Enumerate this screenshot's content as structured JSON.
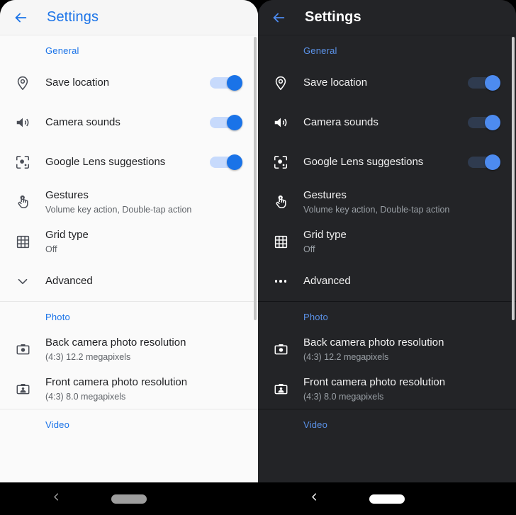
{
  "colors": {
    "light_bg": "#fafafa",
    "dark_bg": "#232427",
    "accent_light": "#1a73e8",
    "accent_dark": "#5b92e8",
    "toggle_track_light": "#c7dafc",
    "toggle_track_dark": "#2f3b4f",
    "toggle_knob_light": "#1a73e8",
    "toggle_knob_dark": "#4d8bf0",
    "navbar_bg": "#000000"
  },
  "panels": [
    {
      "theme": "light",
      "header": {
        "title": "Settings",
        "back_icon": "arrow-left-icon"
      },
      "advanced_icon": "chevron-down-icon",
      "navbar": {
        "back_icon": "chevron-left-icon",
        "home_indicator": "pill-home-indicator"
      }
    },
    {
      "theme": "dark",
      "header": {
        "title": "Settings",
        "back_icon": "arrow-left-icon"
      },
      "advanced_icon": "overflow-dots-icon",
      "navbar": {
        "back_icon": "chevron-left-icon",
        "home_indicator": "pill-home-indicator"
      }
    }
  ],
  "sections": [
    {
      "label": "General",
      "rows": [
        {
          "icon": "location-pin-icon",
          "title": "Save location",
          "subtitle": "",
          "control": "toggle",
          "toggle_on": true
        },
        {
          "icon": "volume-up-icon",
          "title": "Camera sounds",
          "subtitle": "",
          "control": "toggle",
          "toggle_on": true
        },
        {
          "icon": "google-lens-icon",
          "title": "Google Lens suggestions",
          "subtitle": "",
          "control": "toggle",
          "toggle_on": true
        },
        {
          "icon": "touch-gesture-icon",
          "title": "Gestures",
          "subtitle": "Volume key action, Double-tap action",
          "control": "none"
        },
        {
          "icon": "grid-icon",
          "title": "Grid type",
          "subtitle": "Off",
          "control": "none"
        },
        {
          "icon": "advanced-expand-icon",
          "title": "Advanced",
          "subtitle": "",
          "control": "none"
        }
      ]
    },
    {
      "label": "Photo",
      "rows": [
        {
          "icon": "back-camera-icon",
          "title": "Back camera photo resolution",
          "subtitle": "(4:3) 12.2 megapixels",
          "control": "none"
        },
        {
          "icon": "front-camera-icon",
          "title": "Front camera photo resolution",
          "subtitle": "(4:3) 8.0 megapixels",
          "control": "none"
        }
      ]
    },
    {
      "label": "Video",
      "rows": []
    }
  ]
}
